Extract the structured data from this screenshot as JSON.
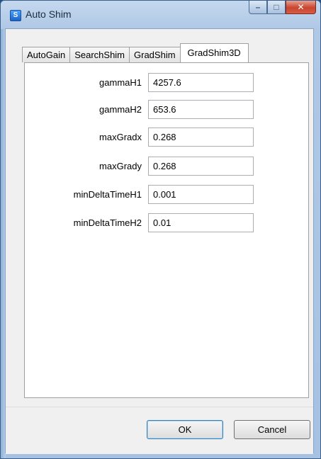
{
  "window": {
    "title": "Auto Shim",
    "app_icon_glyph": "S"
  },
  "tabs": [
    {
      "label": "AutoGain",
      "active": false
    },
    {
      "label": "SearchShim",
      "active": false
    },
    {
      "label": "GradShim",
      "active": false
    },
    {
      "label": "GradShim3D",
      "active": true
    }
  ],
  "fields": [
    {
      "label": "gammaH1",
      "value": "4257.6"
    },
    {
      "label": "gammaH2",
      "value": "653.6"
    },
    {
      "label": "maxGradx",
      "value": "0.268"
    },
    {
      "label": "maxGrady",
      "value": "0.268"
    },
    {
      "label": "minDeltaTimeH1",
      "value": "0.001"
    },
    {
      "label": "minDeltaTimeH2",
      "value": "0.01"
    }
  ],
  "buttons": {
    "ok": "OK",
    "cancel": "Cancel"
  },
  "icons": {
    "minimize": "minimize-icon",
    "maximize": "maximize-icon",
    "close": "close-icon"
  }
}
